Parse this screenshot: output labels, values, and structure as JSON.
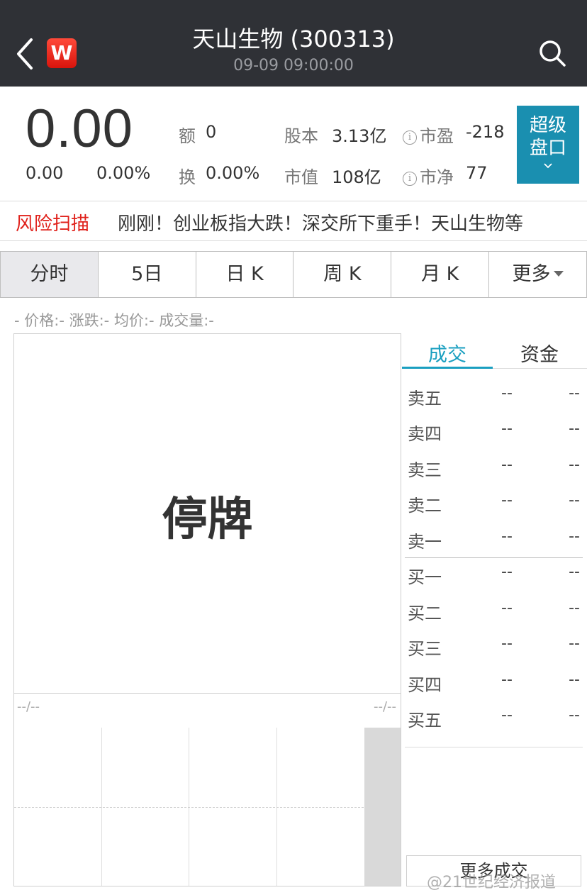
{
  "header": {
    "title": "天山生物 (300313)",
    "subtitle": "09-09 09:00:00",
    "logo_text": "W"
  },
  "quote": {
    "price": "0.00",
    "change": "0.00",
    "change_pct": "0.00%",
    "amount_label": "额",
    "amount_value": "0",
    "turnover_label": "换",
    "turnover_value": "0.00%",
    "share_cap_label": "股本",
    "share_cap_value": "3.13亿",
    "market_cap_label": "市值",
    "market_cap_value": "108亿",
    "pe_label": "市盈",
    "pe_value": "-218",
    "pb_label": "市净",
    "pb_value": "77",
    "info_glyph": "i",
    "super_button_line1": "超级",
    "super_button_line2": "盘口"
  },
  "ticker": {
    "label": "风险扫描",
    "text": "刚刚！创业板指大跌！深交所下重手！天山生物等"
  },
  "tabs": [
    {
      "label": "分时",
      "active": true
    },
    {
      "label": "5日",
      "active": false
    },
    {
      "label": "日 K",
      "active": false
    },
    {
      "label": "周 K",
      "active": false
    },
    {
      "label": "月 K",
      "active": false
    },
    {
      "label": "更多",
      "active": false
    }
  ],
  "legend": "- 价格:-  涨跌:-  均价:-  成交量:-",
  "chart": {
    "halt_text": "停牌",
    "vol_left": "--/--",
    "vol_right": "--/--"
  },
  "book": {
    "tab_trade": "成交",
    "tab_fund": "资金",
    "asks": [
      {
        "label": "卖五",
        "price": "--",
        "vol": "--"
      },
      {
        "label": "卖四",
        "price": "--",
        "vol": "--"
      },
      {
        "label": "卖三",
        "price": "--",
        "vol": "--"
      },
      {
        "label": "卖二",
        "price": "--",
        "vol": "--"
      },
      {
        "label": "卖一",
        "price": "--",
        "vol": "--"
      }
    ],
    "bids": [
      {
        "label": "买一",
        "price": "--",
        "vol": "--"
      },
      {
        "label": "买二",
        "price": "--",
        "vol": "--"
      },
      {
        "label": "买三",
        "price": "--",
        "vol": "--"
      },
      {
        "label": "买四",
        "price": "--",
        "vol": "--"
      },
      {
        "label": "买五",
        "price": "--",
        "vol": "--"
      }
    ],
    "more_label": "更多成交"
  },
  "watermark": "@21世纪经济报道",
  "colors": {
    "header_bg": "#2f3136",
    "accent": "#1a9fc0",
    "risk_red": "#e0211b"
  }
}
